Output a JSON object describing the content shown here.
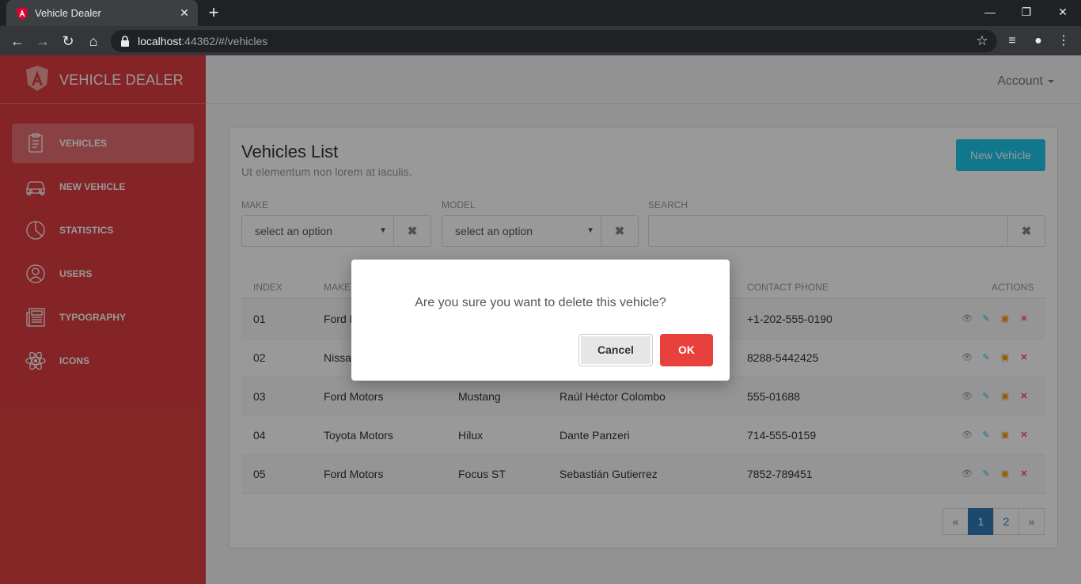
{
  "browser": {
    "tab_title": "Vehicle Dealer",
    "url_host": "localhost",
    "url_rest": ":44362/#/vehicles"
  },
  "sidebar": {
    "brand": "VEHICLE DEALER",
    "items": [
      {
        "label": "VEHICLES",
        "icon": "clipboard-icon"
      },
      {
        "label": "NEW VEHICLE",
        "icon": "car-icon"
      },
      {
        "label": "STATISTICS",
        "icon": "pie-chart-icon"
      },
      {
        "label": "USERS",
        "icon": "user-icon"
      },
      {
        "label": "TYPOGRAPHY",
        "icon": "newspaper-icon"
      },
      {
        "label": "ICONS",
        "icon": "atom-icon"
      }
    ]
  },
  "header": {
    "account_label": "Account"
  },
  "card": {
    "title": "Vehicles List",
    "subtitle": "Ut elementum non lorem at iaculis.",
    "new_button": "New Vehicle"
  },
  "filters": {
    "make_label": "MAKE",
    "make_value": "select an option",
    "model_label": "MODEL",
    "model_value": "select an option",
    "search_label": "SEARCH"
  },
  "table": {
    "headers": {
      "index": "INDEX",
      "make": "MAKE",
      "phone": "CONTACT PHONE",
      "actions": "ACTIONS"
    },
    "rows": [
      {
        "index": "01",
        "make": "Ford M",
        "model": "",
        "contact": "",
        "phone": "+1-202-555-0190"
      },
      {
        "index": "02",
        "make": "Nissa",
        "model": "",
        "contact": "",
        "phone": "8288-5442425"
      },
      {
        "index": "03",
        "make": "Ford Motors",
        "model": "Mustang",
        "contact": "Raúl Héctor Colombo",
        "phone": "555-01688"
      },
      {
        "index": "04",
        "make": "Toyota Motors",
        "model": "Hilux",
        "contact": "Dante Panzeri",
        "phone": "714-555-0159"
      },
      {
        "index": "05",
        "make": "Ford Motors",
        "model": "Focus ST",
        "contact": "Sebastián Gutierrez",
        "phone": "7852-789451"
      }
    ]
  },
  "pagination": {
    "prev": "«",
    "pages": [
      "1",
      "2"
    ],
    "next": "»",
    "current": "1"
  },
  "dialog": {
    "message": "Are you sure you want to delete this vehicle?",
    "cancel_label": "Cancel",
    "ok_label": "OK"
  },
  "colors": {
    "sidebar": "#dc3d40",
    "primary_button": "#1dc7ea",
    "ok_button": "#e8403d",
    "page_active": "#337ab7"
  }
}
